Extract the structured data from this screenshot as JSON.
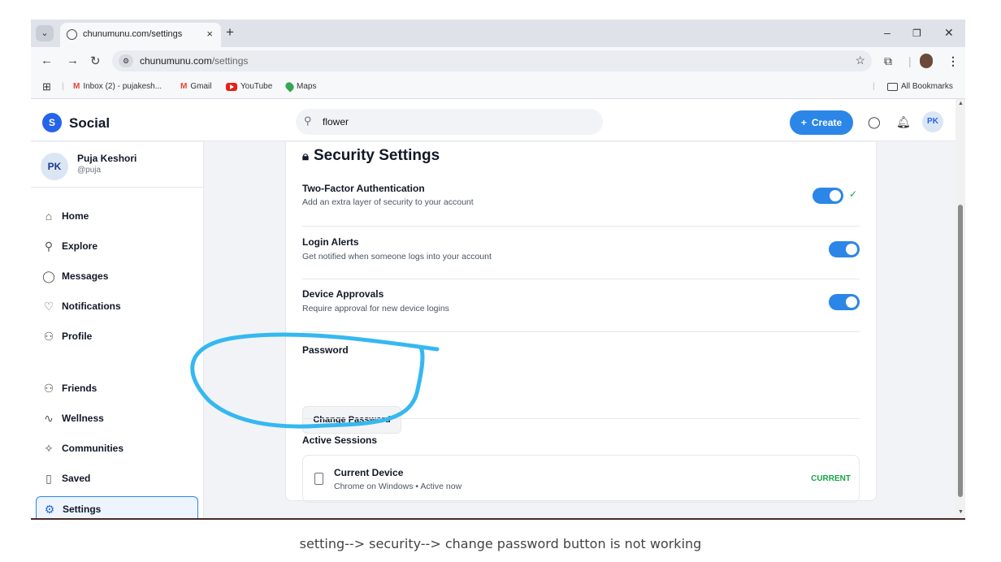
{
  "browser": {
    "tab_title": "chunumunu.com/settings",
    "tab_close": "×",
    "new_tab": "+",
    "url_domain": "chunumunu.com",
    "url_path": "/settings",
    "bookmarks": [
      "Inbox (2) - pujakesh...",
      "Gmail",
      "YouTube",
      "Maps"
    ],
    "all_bookmarks": "All Bookmarks"
  },
  "app": {
    "logo_letter": "S",
    "brand": "Social",
    "search_value": "flower",
    "create_label": "Create",
    "user_initials": "PK"
  },
  "sidebar": {
    "user_name": "Puja Keshori",
    "user_handle": "@puja",
    "user_initials": "PK",
    "items": [
      {
        "label": "Home",
        "icon": "home-icon"
      },
      {
        "label": "Explore",
        "icon": "search-icon"
      },
      {
        "label": "Messages",
        "icon": "message-icon"
      },
      {
        "label": "Notifications",
        "icon": "heart-icon"
      },
      {
        "label": "Profile",
        "icon": "user-icon"
      },
      {
        "label": "Friends",
        "icon": "users-icon"
      },
      {
        "label": "Wellness",
        "icon": "pulse-icon"
      },
      {
        "label": "Communities",
        "icon": "sparkle-icon"
      },
      {
        "label": "Saved",
        "icon": "bookmark-icon"
      },
      {
        "label": "Settings",
        "icon": "gear-icon"
      }
    ],
    "active": "Settings"
  },
  "security": {
    "title": "Security Settings",
    "two_factor_title": "Two-Factor Authentication",
    "two_factor_desc": "Add an extra layer of security to your account",
    "two_factor_on": true,
    "login_alerts_title": "Login Alerts",
    "login_alerts_desc": "Get notified when someone logs into your account",
    "login_alerts_on": true,
    "device_approvals_title": "Device Approvals",
    "device_approvals_desc": "Require approval for new device logins",
    "device_approvals_on": true,
    "password_title": "Password",
    "change_password_label": "Change Password",
    "active_sessions_title": "Active Sessions",
    "session_device": "Current Device",
    "session_detail": "Chrome on Windows • Active now",
    "session_badge": "CURRENT"
  },
  "caption": "setting--> security--> change password button is not working",
  "colors": {
    "accent": "#2b86e8",
    "annotation": "#35b8f0",
    "success": "#16a34a"
  }
}
